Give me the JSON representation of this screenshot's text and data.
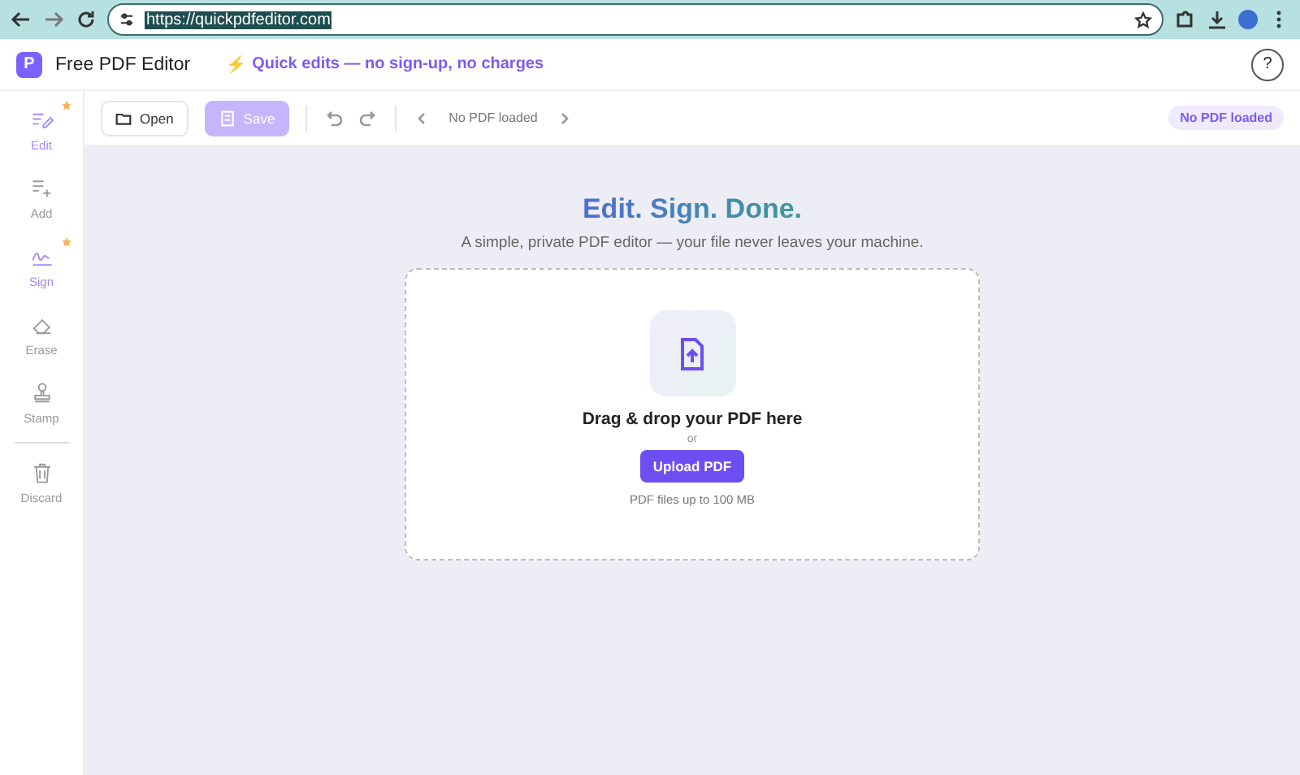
{
  "browser": {
    "url": "https://quickpdfeditor.com"
  },
  "header": {
    "logo": "P",
    "title": "Free PDF Editor",
    "tagline_icon": "⚡",
    "tagline": "Quick edits — no sign-up, no charges",
    "help": "?"
  },
  "sidebar": {
    "items": [
      {
        "label": "Edit",
        "kind": "edit",
        "starred": true
      },
      {
        "label": "Add",
        "kind": "add",
        "starred": false
      },
      {
        "label": "Sign",
        "kind": "sign",
        "starred": true
      },
      {
        "label": "Erase",
        "kind": "erase",
        "starred": false
      },
      {
        "label": "Stamp",
        "kind": "stamp",
        "starred": false
      },
      {
        "label": "Discard",
        "kind": "discard",
        "starred": false
      }
    ]
  },
  "toolbar": {
    "open": {
      "label": "Open",
      "disabled": false
    },
    "save": {
      "label": "Save",
      "disabled": true
    },
    "page_status": "No PDF loaded",
    "badge": "No PDF loaded"
  },
  "hero": {
    "title": "Edit. Sign. Done.",
    "subtitle": "A simple, private PDF editor — your file never leaves your machine."
  },
  "dropzone": {
    "heading": "Drag & drop your PDF here",
    "or": "or",
    "button": "Upload PDF",
    "note": "PDF files up to 100 MB"
  }
}
